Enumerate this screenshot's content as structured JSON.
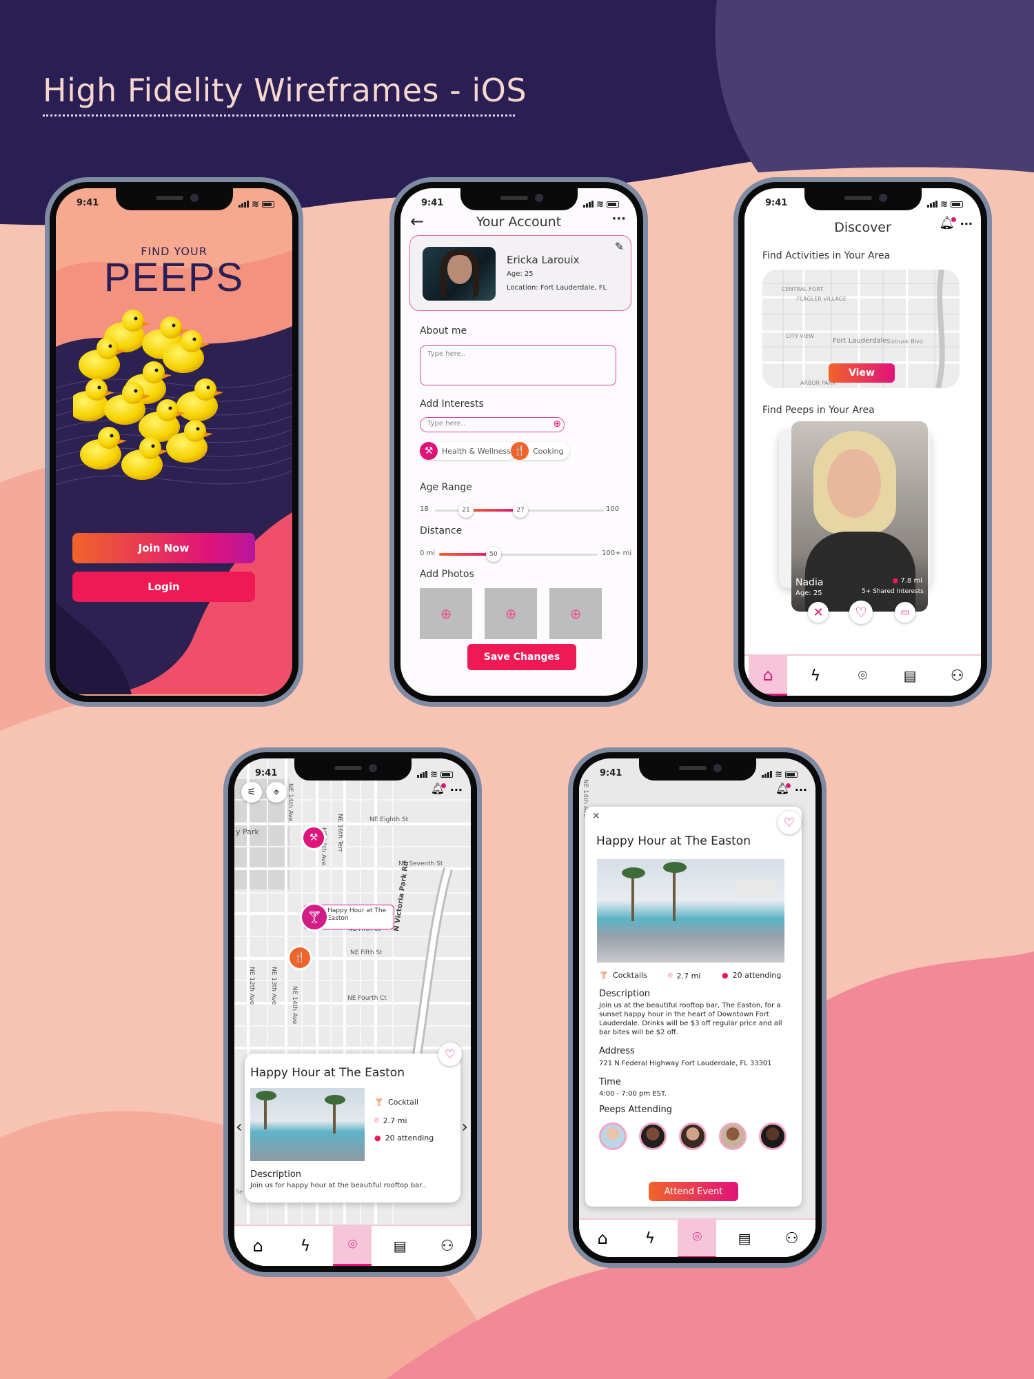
{
  "page": {
    "title": "High Fidelity Wireframes - iOS"
  },
  "status": {
    "time": "9:41"
  },
  "colors": {
    "navy": "#2a1f55",
    "pink": "#ee1955",
    "orange": "#f0642a",
    "magenta": "#e0137a",
    "peach": "#f7c3b3"
  },
  "onboarding": {
    "tagline": "FIND YOUR",
    "logo": "PEEPS",
    "join_label": "Join Now",
    "login_label": "Login"
  },
  "account": {
    "title": "Your Account",
    "profile": {
      "name": "Ericka Larouix",
      "age": "Age: 25",
      "location": "Location: Fort Lauderdale, FL"
    },
    "about_label": "About me",
    "about_placeholder": "Type here..",
    "interests_label": "Add Interests",
    "interests_placeholder": "Type here..",
    "tags": [
      {
        "label": "Health & Wellness",
        "icon": "dumbbell-icon"
      },
      {
        "label": "Cooking",
        "icon": "fork-knife-icon"
      }
    ],
    "age_label": "Age Range",
    "age": {
      "min": "18",
      "low": "21",
      "high": "27",
      "max": "100"
    },
    "distance_label": "Distance",
    "distance": {
      "min": "0 mi",
      "value": "50",
      "max": "100+ mi"
    },
    "photos_label": "Add Photos",
    "save_label": "Save Changes"
  },
  "discover": {
    "title": "Discover",
    "activities_label": "Find Activities in Your Area",
    "view_label": "View",
    "peeps_label": "Find Peeps in Your Area",
    "person": {
      "name": "Nadia",
      "age": "Age: 25",
      "distance": "7.8 mi",
      "shared": "5+ Shared Interests"
    },
    "map_labels": [
      "CENTRAL FORT",
      "FLAGLER VILLAGE",
      "CITY VIEW",
      "Fort Lauderdale",
      "Sistrunk Blvd",
      "ARBOR PARK"
    ]
  },
  "map_screen": {
    "streets": [
      "NE Eighth St",
      "NE Seventh St",
      "NE Fifth Ct",
      "NE Fifth St",
      "NE Fourth Ct",
      "N Victoria Park Rd",
      "NE 14th Ave",
      "NE 16th Ave",
      "NE 16th Terr",
      "NE 12th Ave",
      "NE 13th Ave",
      "NE 14th Ave"
    ],
    "park": "y Park",
    "pin_label": "Happy Hour at The Easton",
    "card_title": "Happy Hour at The Easton",
    "category": "Cocktail",
    "distance": "2.7 mi",
    "attending": "20 attending",
    "desc_label": "Description",
    "desc_text": "Join us for happy hour at the beautiful rooftop bar..",
    "partial_street": "Se"
  },
  "event": {
    "title": "Happy Hour at The Easton",
    "category": "Cocktails",
    "distance": "2.7 mi",
    "attending": "20 attending",
    "desc_label": "Description",
    "desc_text": "Join us at the beautiful rooftop bar, The Easton, for a sunset happy hour in the heart of Downtown Fort Lauderdale. Drinks will be $3 off regular price and all bar bites will be $2 off.",
    "address_label": "Address",
    "address": "721 N Federal Highway Fort Lauderdale, FL 33301",
    "time_label": "Time",
    "time": "4:00 - 7:00 pm EST.",
    "peeps_label": "Peeps Attending",
    "attend_label": "Attend Event",
    "bg_street": "NE 14th Ave"
  }
}
